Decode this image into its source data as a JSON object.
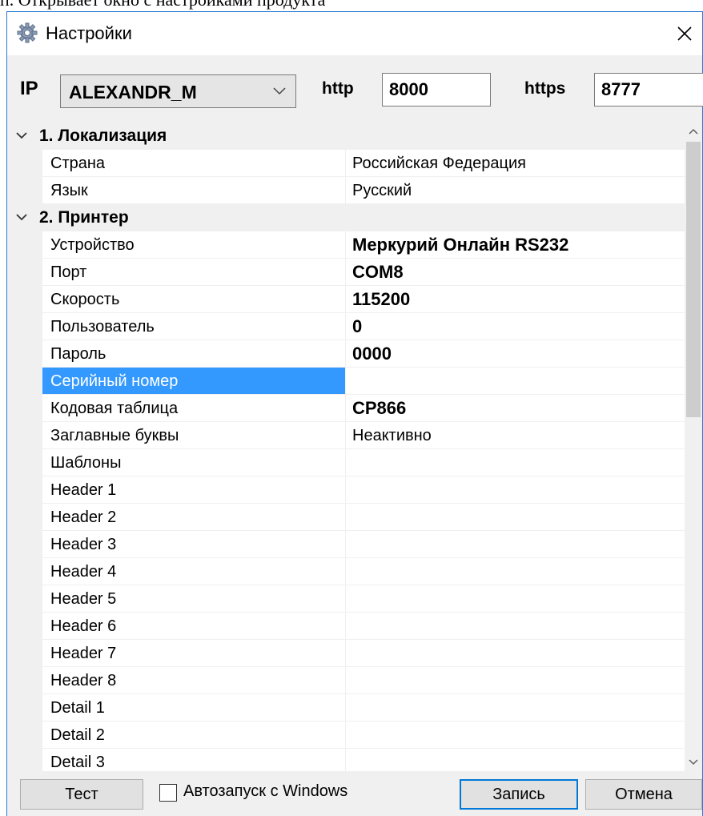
{
  "document_caption": "п. Открывает окно с настройками продукта",
  "window": {
    "title": "Настройки"
  },
  "toolbar": {
    "ip_label": "IP",
    "ip_value": "ALEXANDR_M",
    "http_label": "http",
    "http_value": "8000",
    "https_label": "https",
    "https_value": "8777"
  },
  "grid": {
    "categories": [
      {
        "title": "1. Локализация",
        "rows": [
          {
            "name": "Страна",
            "value": "Российская Федерация"
          },
          {
            "name": "Язык",
            "value": "Русский"
          }
        ]
      },
      {
        "title": "2. Принтер",
        "rows": [
          {
            "name": "Устройство",
            "value": "Меркурий Онлайн RS232"
          },
          {
            "name": "Порт",
            "value": "COM8"
          },
          {
            "name": "Скорость",
            "value": "115200"
          },
          {
            "name": "Пользователь",
            "value": "0"
          },
          {
            "name": "Пароль",
            "value": "0000"
          },
          {
            "name": "Серийный номер",
            "value": ""
          },
          {
            "name": "Кодовая таблица",
            "value": "CP866"
          },
          {
            "name": "Заглавные буквы",
            "value": "Неактивно"
          },
          {
            "name": "Шаблоны",
            "value": ""
          },
          {
            "name": "Header 1",
            "value": ""
          },
          {
            "name": "Header 2",
            "value": ""
          },
          {
            "name": "Header 3",
            "value": ""
          },
          {
            "name": "Header 4",
            "value": ""
          },
          {
            "name": "Header 5",
            "value": ""
          },
          {
            "name": "Header 6",
            "value": ""
          },
          {
            "name": "Header 7",
            "value": ""
          },
          {
            "name": "Header 8",
            "value": ""
          },
          {
            "name": "Detail 1",
            "value": ""
          },
          {
            "name": "Detail 2",
            "value": ""
          },
          {
            "name": "Detail 3",
            "value": ""
          }
        ]
      }
    ],
    "selected_row": "Серийный номер"
  },
  "bottom": {
    "test_label": "Тест",
    "autostart_label": "Автозапуск с Windows",
    "autostart_checked": false,
    "save_label": "Запись",
    "cancel_label": "Отмена"
  },
  "colors": {
    "window_border": "#2b79d6",
    "selection": "#3399ff",
    "default_button_border": "#0078d7",
    "panel_background": "#f0f0f0"
  }
}
